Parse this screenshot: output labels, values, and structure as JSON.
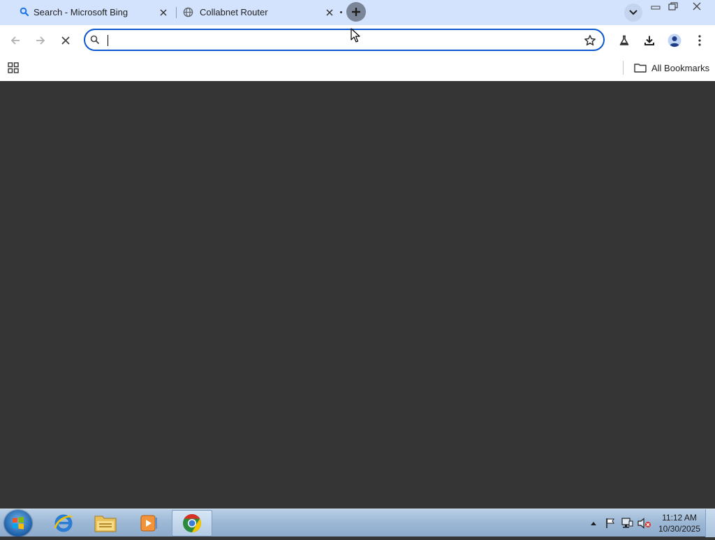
{
  "tabs": [
    {
      "title": "Search - Microsoft Bing",
      "favicon": "bing-search-icon",
      "active": false
    },
    {
      "title": "Collabnet Router",
      "favicon": "globe-icon",
      "active": true
    }
  ],
  "toolbar": {
    "address_value": "",
    "address_placeholder": ""
  },
  "bookmarks": {
    "all_bookmarks_label": "All Bookmarks"
  },
  "taskbar": {
    "time": "11:12 AM",
    "date": "10/30/2025",
    "pinned": [
      "start-orb",
      "internet-explorer-icon",
      "file-explorer-icon",
      "media-player-icon",
      "chrome-icon"
    ]
  },
  "colors": {
    "tabstrip_bg": "#d3e3fd",
    "accent": "#0b57d0",
    "content_bg": "#353535"
  }
}
